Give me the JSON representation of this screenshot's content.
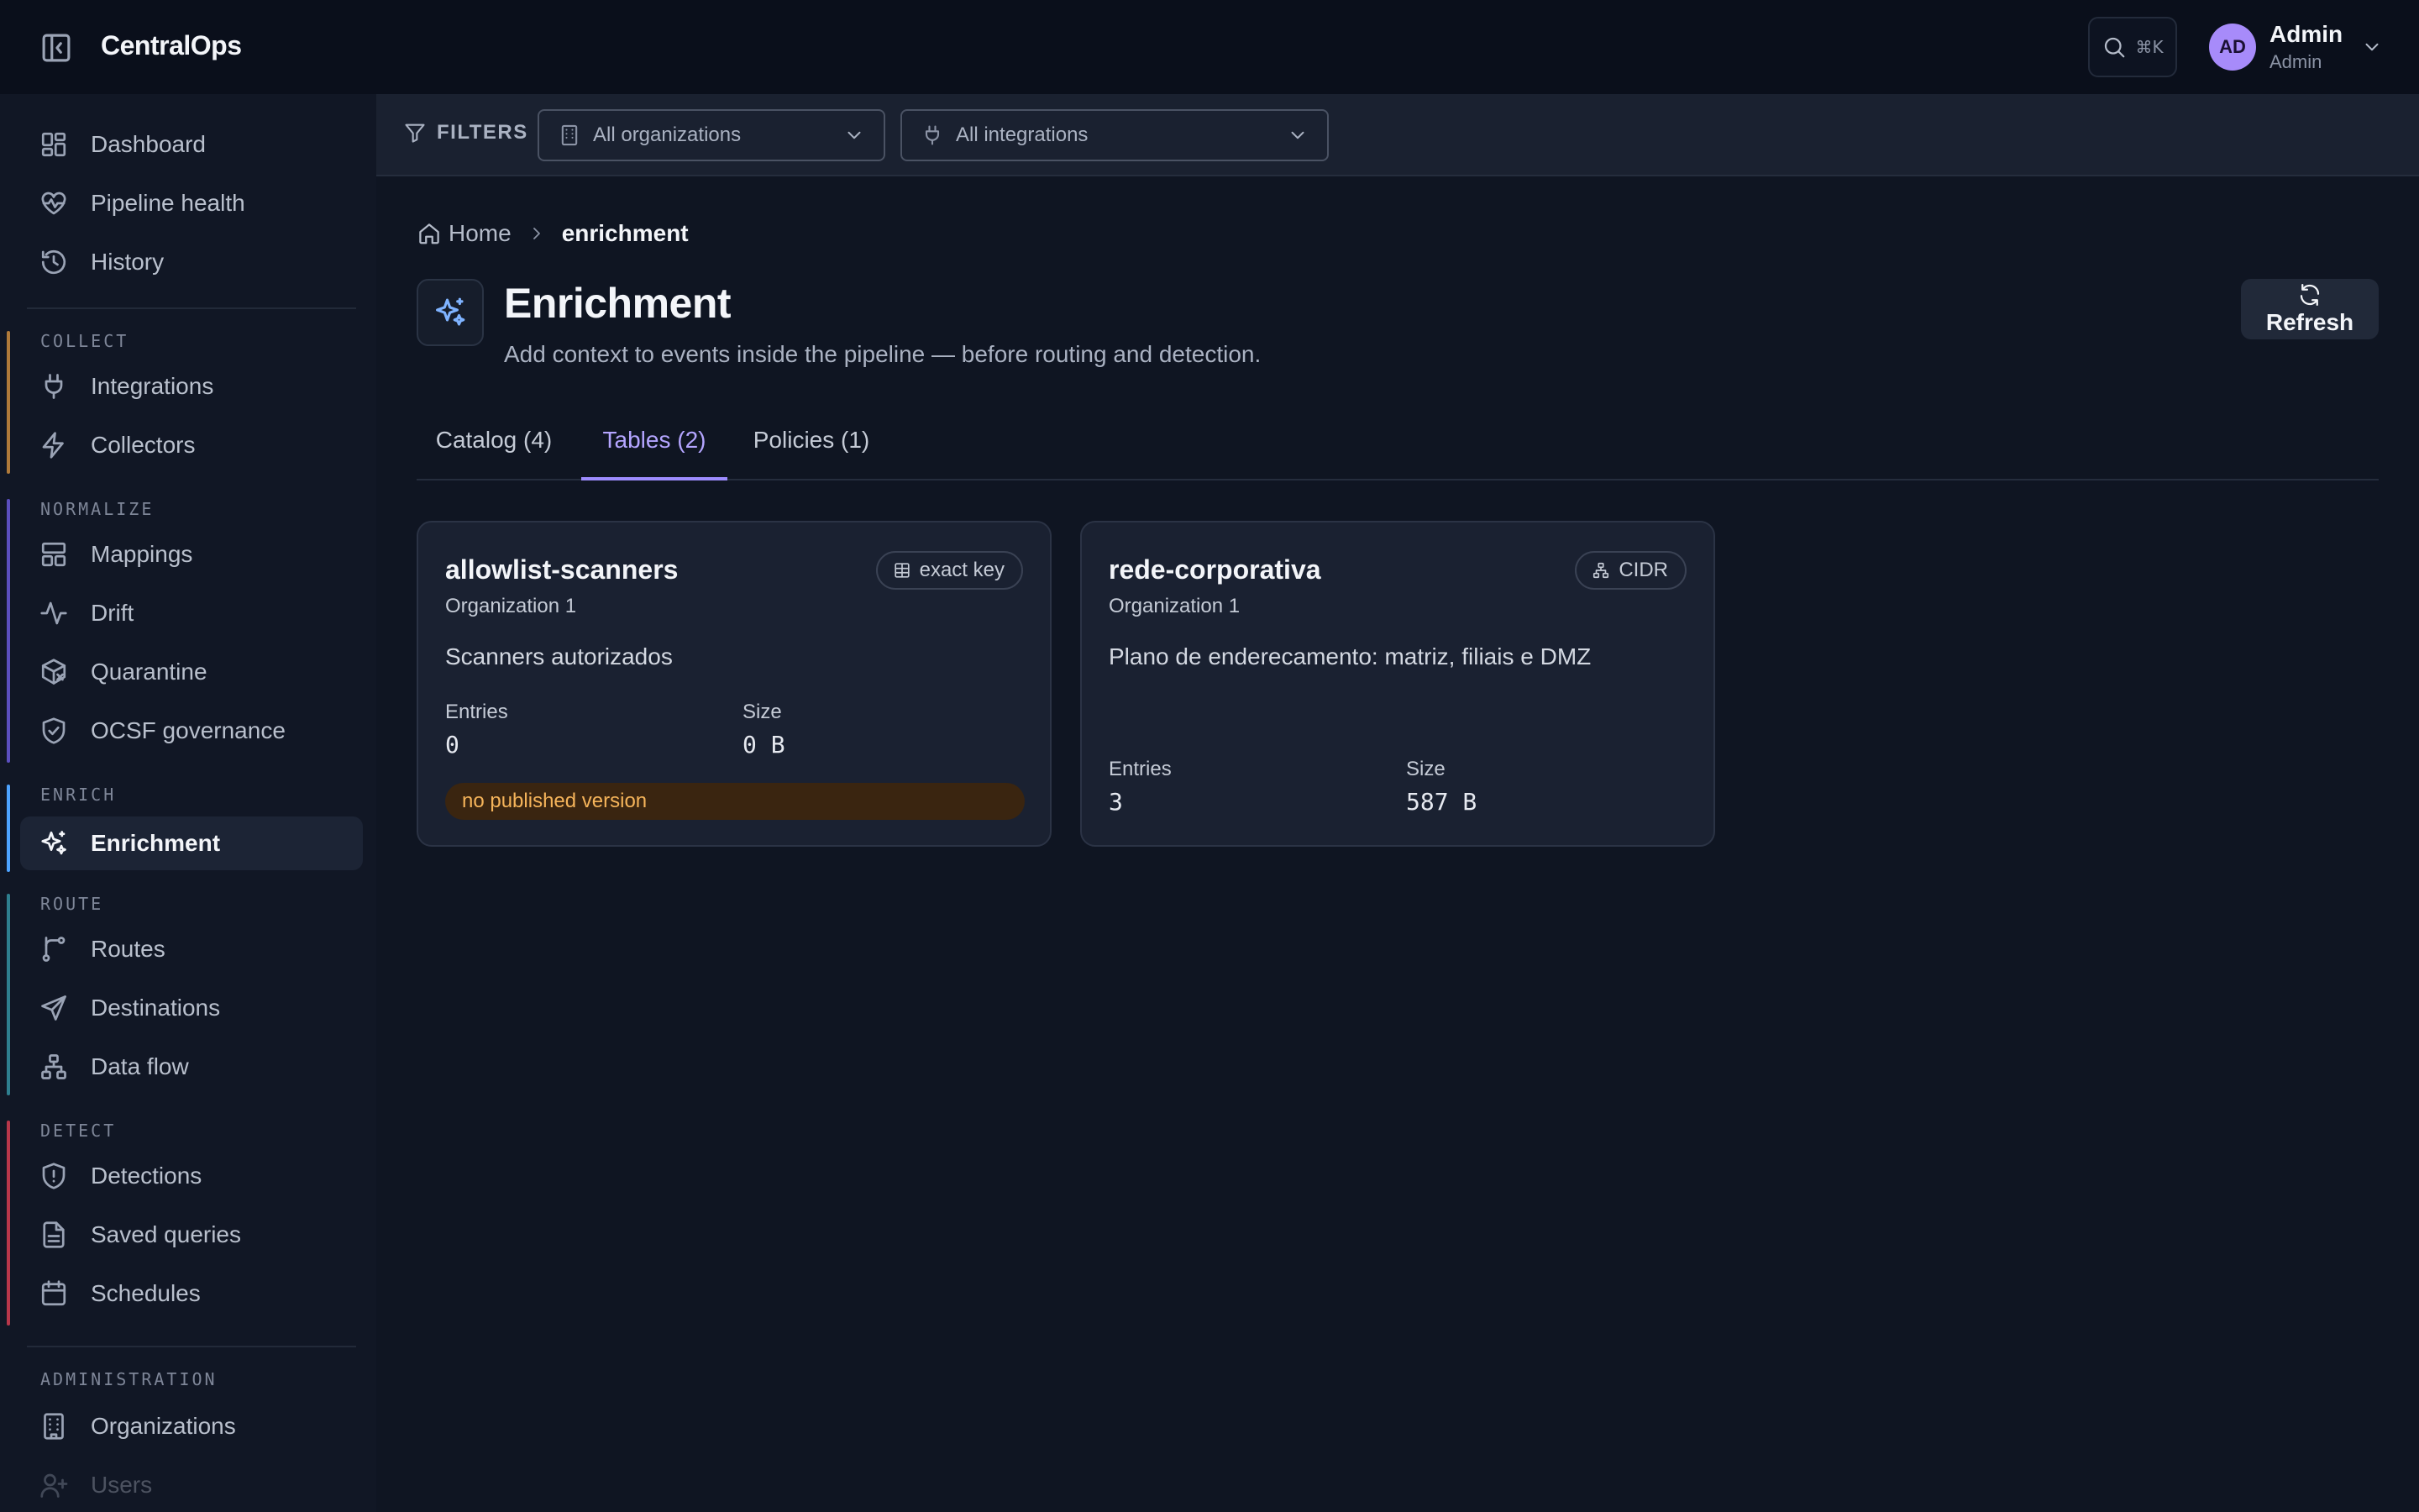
{
  "app": {
    "title": "CentralOps"
  },
  "search": {
    "shortcut": "⌘K"
  },
  "user": {
    "initials": "AD",
    "name": "Admin",
    "role": "Admin"
  },
  "sidebar": {
    "top_items": [
      {
        "label": "Dashboard",
        "icon": "grid-icon"
      },
      {
        "label": "Pipeline health",
        "icon": "heart-pulse-icon"
      },
      {
        "label": "History",
        "icon": "history-icon"
      }
    ],
    "sections": [
      {
        "label": "COLLECT",
        "color": "#b07a3a",
        "items": [
          {
            "label": "Integrations",
            "icon": "plug-icon"
          },
          {
            "label": "Collectors",
            "icon": "bolt-icon"
          }
        ]
      },
      {
        "label": "NORMALIZE",
        "color": "#5b4fbf",
        "items": [
          {
            "label": "Mappings",
            "icon": "layout-icon"
          },
          {
            "label": "Drift",
            "icon": "activity-icon"
          },
          {
            "label": "Quarantine",
            "icon": "package-x-icon"
          },
          {
            "label": "OCSF governance",
            "icon": "shield-check-icon"
          }
        ]
      },
      {
        "label": "ENRICH",
        "color": "#4da3ff",
        "items": [
          {
            "label": "Enrichment",
            "icon": "sparkles-icon",
            "active": true
          }
        ]
      },
      {
        "label": "ROUTE",
        "color": "#2e7f8f",
        "items": [
          {
            "label": "Routes",
            "icon": "git-branch-icon"
          },
          {
            "label": "Destinations",
            "icon": "send-icon"
          },
          {
            "label": "Data flow",
            "icon": "network-icon"
          }
        ]
      },
      {
        "label": "DETECT",
        "color": "#b8374a",
        "items": [
          {
            "label": "Detections",
            "icon": "shield-alert-icon"
          },
          {
            "label": "Saved queries",
            "icon": "file-text-icon"
          },
          {
            "label": "Schedules",
            "icon": "calendar-icon"
          }
        ]
      },
      {
        "label": "ADMINISTRATION",
        "color": "",
        "items": [
          {
            "label": "Organizations",
            "icon": "building-icon"
          },
          {
            "label": "Users",
            "icon": "user-plus-icon"
          }
        ]
      }
    ]
  },
  "filters": {
    "label": "FILTERS",
    "organization": {
      "value": "All organizations"
    },
    "integration": {
      "value": "All integrations"
    }
  },
  "breadcrumb": {
    "home": "Home",
    "current": "enrichment"
  },
  "page": {
    "title": "Enrichment",
    "subtitle": "Add context to events inside the pipeline — before routing and detection.",
    "refresh_label": "Refresh"
  },
  "tabs": [
    {
      "label": "Catalog (4)",
      "active": false
    },
    {
      "label": "Tables (2)",
      "active": true
    },
    {
      "label": "Policies (1)",
      "active": false
    }
  ],
  "tables": [
    {
      "name": "allowlist-scanners",
      "org": "Organization 1",
      "badge": "exact key",
      "badge_icon": "table-icon",
      "description": "Scanners autorizados",
      "entries_label": "Entries",
      "entries": "0",
      "size_label": "Size",
      "size": "0 B",
      "warning": "no published version"
    },
    {
      "name": "rede-corporativa",
      "org": "Organization 1",
      "badge": "CIDR",
      "badge_icon": "network-icon",
      "description": "Plano de enderecamento: matriz, filiais e DMZ",
      "entries_label": "Entries",
      "entries": "3",
      "size_label": "Size",
      "size": "587 B"
    }
  ]
}
